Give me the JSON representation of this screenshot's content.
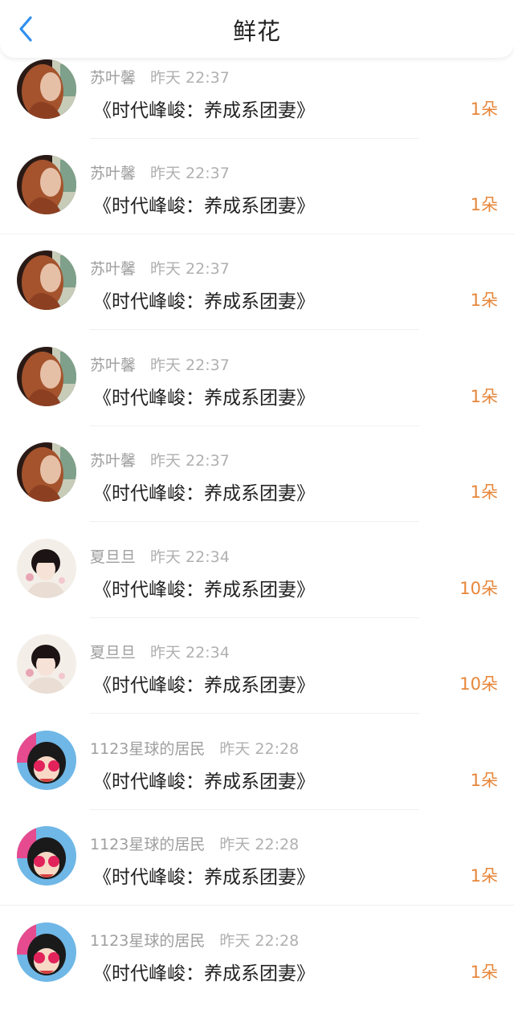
{
  "header": {
    "title": "鲜花"
  },
  "colors": {
    "accent_blue": "#2f8ff0",
    "amount_orange": "#e7863a"
  },
  "items": [
    {
      "user": "苏叶馨",
      "time": "昨天 22:37",
      "book": "《时代峰峻：养成系团妻》",
      "amount": "1朵",
      "avatar": "avatar-woman-red-hair"
    },
    {
      "user": "苏叶馨",
      "time": "昨天 22:37",
      "book": "《时代峰峻：养成系团妻》",
      "amount": "1朵",
      "avatar": "avatar-woman-red-hair"
    },
    {
      "user": "苏叶馨",
      "time": "昨天 22:37",
      "book": "《时代峰峻：养成系团妻》",
      "amount": "1朵",
      "avatar": "avatar-woman-red-hair"
    },
    {
      "user": "苏叶馨",
      "time": "昨天 22:37",
      "book": "《时代峰峻：养成系团妻》",
      "amount": "1朵",
      "avatar": "avatar-woman-red-hair"
    },
    {
      "user": "苏叶馨",
      "time": "昨天 22:37",
      "book": "《时代峰峻：养成系团妻》",
      "amount": "1朵",
      "avatar": "avatar-woman-red-hair"
    },
    {
      "user": "夏旦旦",
      "time": "昨天 22:34",
      "book": "《时代峰峻：养成系团妻》",
      "amount": "10朵",
      "avatar": "avatar-girl-flowers"
    },
    {
      "user": "夏旦旦",
      "time": "昨天 22:34",
      "book": "《时代峰峻：养成系团妻》",
      "amount": "10朵",
      "avatar": "avatar-girl-flowers"
    },
    {
      "user": "1123星球的居民",
      "time": "昨天 22:28",
      "book": "《时代峰峻：养成系团妻》",
      "amount": "1朵",
      "avatar": "avatar-cartoon-tnt"
    },
    {
      "user": "1123星球的居民",
      "time": "昨天 22:28",
      "book": "《时代峰峻：养成系团妻》",
      "amount": "1朵",
      "avatar": "avatar-cartoon-tnt"
    },
    {
      "user": "1123星球的居民",
      "time": "昨天 22:28",
      "book": "《时代峰峻：养成系团妻》",
      "amount": "1朵",
      "avatar": "avatar-cartoon-tnt"
    }
  ]
}
